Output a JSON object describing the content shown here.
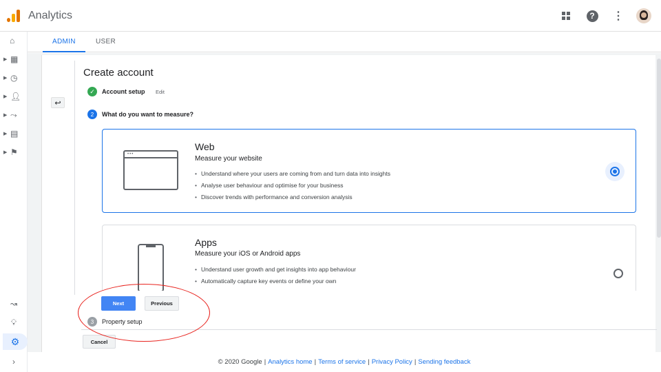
{
  "app": {
    "title": "Analytics"
  },
  "tabs": {
    "admin": "ADMIN",
    "user": "USER"
  },
  "page": {
    "title": "Create account"
  },
  "steps": {
    "step1": {
      "label": "Account setup",
      "edit": "Edit"
    },
    "step2": {
      "number": "2",
      "label": "What do you want to measure?"
    },
    "step3": {
      "number": "3",
      "label": "Property setup"
    }
  },
  "options": {
    "web": {
      "title": "Web",
      "subtitle": "Measure your website",
      "bullets": [
        "Understand where your users are coming from and turn data into insights",
        "Analyse user behaviour and optimise for your business",
        "Discover trends with performance and conversion analysis"
      ],
      "selected": true
    },
    "apps": {
      "title": "Apps",
      "subtitle": "Measure your iOS or Android apps",
      "bullets": [
        "Understand user growth and get insights into app behaviour",
        "Automatically capture key events or define your own"
      ],
      "selected": false
    }
  },
  "buttons": {
    "next": "Next",
    "previous": "Previous",
    "cancel": "Cancel"
  },
  "footer": {
    "copyright": "© 2020 Google",
    "links": [
      "Analytics home",
      "Terms of service",
      "Privacy Policy",
      "Sending feedback"
    ]
  },
  "colors": {
    "accent": "#1a73e8",
    "success": "#34a853",
    "annotation": "#e8231e"
  },
  "icons": {
    "rail": [
      "home-icon",
      "dashboard-icon",
      "clock-icon",
      "person-icon",
      "acquisition-icon",
      "table-icon",
      "flag-icon"
    ],
    "rail_bottom": [
      "route-icon",
      "lightbulb-icon",
      "gear-icon",
      "chevron-right-icon"
    ],
    "top": [
      "apps-grid-icon",
      "help-icon",
      "more-vert-icon",
      "avatar"
    ]
  }
}
